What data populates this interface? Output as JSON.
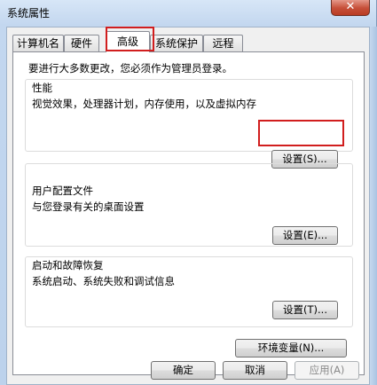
{
  "window": {
    "title": "系统属性",
    "close_symbol": "✕"
  },
  "tabs": [
    {
      "label": "计算机名",
      "active": false
    },
    {
      "label": "硬件",
      "active": false
    },
    {
      "label": "高级",
      "active": true
    },
    {
      "label": "系统保护",
      "active": false
    },
    {
      "label": "远程",
      "active": false
    }
  ],
  "advanced": {
    "admin_notice": "要进行大多数更改，您必须作为管理员登录。",
    "performance": {
      "heading": "性能",
      "description": "视觉效果，处理器计划，内存使用，以及虚拟内存",
      "button": "设置(S)..."
    },
    "user_profiles": {
      "heading": "用户配置文件",
      "description": "与您登录有关的桌面设置",
      "button": "设置(E)..."
    },
    "startup_recovery": {
      "heading": "启动和故障恢复",
      "description": "系统启动、系统失败和调试信息",
      "button": "设置(T)..."
    },
    "env_button": "环境变量(N)..."
  },
  "footer": {
    "ok": "确定",
    "cancel": "取消",
    "apply": "应用(A)"
  },
  "highlight_color": "#d11e1e"
}
